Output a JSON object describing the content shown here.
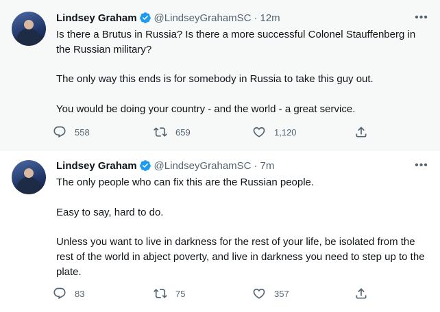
{
  "tweets": [
    {
      "name": "Lindsey Graham",
      "handle": "@LindseyGrahamSC",
      "separator": "·",
      "time": "12m",
      "paragraphs": [
        "Is there a Brutus in Russia?  Is there a more successful Colonel Stauffenberg in the Russian military?",
        "The only way this ends is for somebody in Russia to take this guy out.",
        "You would be doing your country - and the world - a great service."
      ],
      "replies": "558",
      "retweets": "659",
      "likes": "1,120"
    },
    {
      "name": "Lindsey Graham",
      "handle": "@LindseyGrahamSC",
      "separator": "·",
      "time": "7m",
      "paragraphs": [
        "The only people who can fix this are the Russian people.",
        "Easy to say, hard to do.",
        "Unless you want to live in darkness for the rest of your life, be isolated from the rest of the world in abject poverty, and live in darkness you need to step up to the plate."
      ],
      "replies": "83",
      "retweets": "75",
      "likes": "357"
    }
  ],
  "more_glyph": "•••",
  "colors": {
    "verified": "#1d9bf0",
    "secondary_text": "#536471",
    "thread_line": "#cfd9de"
  },
  "icons": [
    "reply-icon",
    "retweet-icon",
    "like-icon",
    "share-icon",
    "verified-badge-icon",
    "more-options-icon"
  ]
}
